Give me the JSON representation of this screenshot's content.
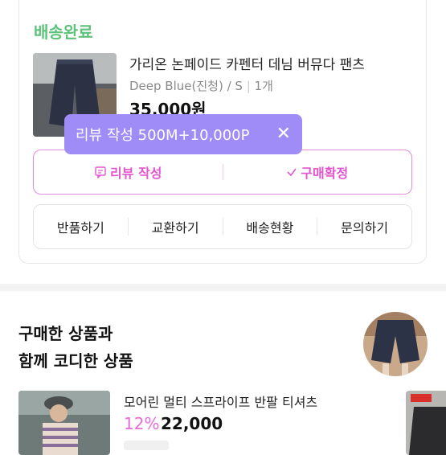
{
  "order": {
    "status": "배송완료",
    "product_name": "가리온 논페이드 카펜터 데님 버뮤다 팬츠",
    "option": "Deep Blue(진청) / S",
    "quantity": "1개",
    "price": "35,000원"
  },
  "tooltip": {
    "text": "리뷰 작성 500M+10,000P",
    "close": "✕"
  },
  "primary_actions": {
    "review": "리뷰 작성",
    "confirm": "구매확정"
  },
  "secondary_actions": [
    "반품하기",
    "교환하기",
    "배송현황",
    "문의하기"
  ],
  "recommend": {
    "title_line1": "구매한 상품과",
    "title_line2": "함께 코디한 상품",
    "item": {
      "name": "모어린 멀티 스프라이프 반팔 티셔츠",
      "discount": "12%",
      "price": "22,000"
    }
  },
  "colors": {
    "status_green": "#5dc27a",
    "accent_pink": "#e256cf",
    "tooltip_purple": "#9f8cf6"
  }
}
